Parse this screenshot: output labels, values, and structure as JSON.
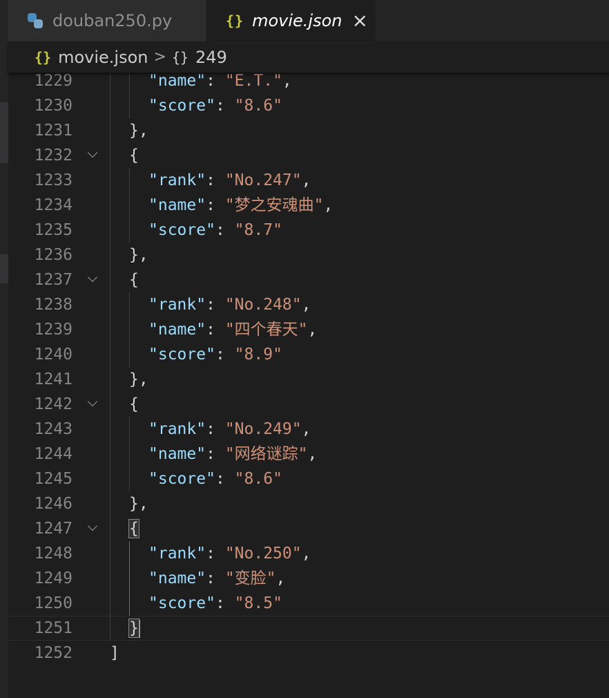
{
  "tabs": [
    {
      "label": "douban250.py",
      "icon": "python-icon",
      "active": false
    },
    {
      "label": "movie.json",
      "icon": "json-braces-icon",
      "active": true
    }
  ],
  "breadcrumb": {
    "file_icon": "{}",
    "file": "movie.json",
    "separator": ">",
    "node_icon": "{}",
    "node": "249"
  },
  "editor": {
    "lines": [
      {
        "num": "1229",
        "indent": 2,
        "key": "name",
        "value": "E.T.",
        "comma": true
      },
      {
        "num": "1230",
        "indent": 2,
        "key": "score",
        "value": "8.6",
        "comma": false
      },
      {
        "num": "1231",
        "indent": 1,
        "text": "},"
      },
      {
        "num": "1232",
        "indent": 1,
        "text": "{",
        "fold": true
      },
      {
        "num": "1233",
        "indent": 2,
        "key": "rank",
        "value": "No.247",
        "comma": true
      },
      {
        "num": "1234",
        "indent": 2,
        "key": "name",
        "value": "梦之安魂曲",
        "comma": true
      },
      {
        "num": "1235",
        "indent": 2,
        "key": "score",
        "value": "8.7",
        "comma": false
      },
      {
        "num": "1236",
        "indent": 1,
        "text": "},"
      },
      {
        "num": "1237",
        "indent": 1,
        "text": "{",
        "fold": true
      },
      {
        "num": "1238",
        "indent": 2,
        "key": "rank",
        "value": "No.248",
        "comma": true
      },
      {
        "num": "1239",
        "indent": 2,
        "key": "name",
        "value": "四个春天",
        "comma": true
      },
      {
        "num": "1240",
        "indent": 2,
        "key": "score",
        "value": "8.9",
        "comma": false
      },
      {
        "num": "1241",
        "indent": 1,
        "text": "},"
      },
      {
        "num": "1242",
        "indent": 1,
        "text": "{",
        "fold": true
      },
      {
        "num": "1243",
        "indent": 2,
        "key": "rank",
        "value": "No.249",
        "comma": true
      },
      {
        "num": "1244",
        "indent": 2,
        "key": "name",
        "value": "网络谜踪",
        "comma": true
      },
      {
        "num": "1245",
        "indent": 2,
        "key": "score",
        "value": "8.6",
        "comma": false
      },
      {
        "num": "1246",
        "indent": 1,
        "text": "},"
      },
      {
        "num": "1247",
        "indent": 1,
        "text": "{",
        "fold": true,
        "match": true
      },
      {
        "num": "1248",
        "indent": 2,
        "key": "rank",
        "value": "No.250",
        "comma": true
      },
      {
        "num": "1249",
        "indent": 2,
        "key": "name",
        "value": "变脸",
        "comma": true
      },
      {
        "num": "1250",
        "indent": 2,
        "key": "score",
        "value": "8.5",
        "comma": false
      },
      {
        "num": "1251",
        "indent": 1,
        "text": "}",
        "match": true,
        "cursor": true,
        "current": true
      },
      {
        "num": "1252",
        "indent": 0,
        "text": "]"
      }
    ]
  },
  "colors": {
    "key": "#9cdcfe",
    "string": "#ce9178",
    "line_number": "#858585",
    "json_icon": "#cbcb41",
    "background": "#1e1e1e"
  }
}
